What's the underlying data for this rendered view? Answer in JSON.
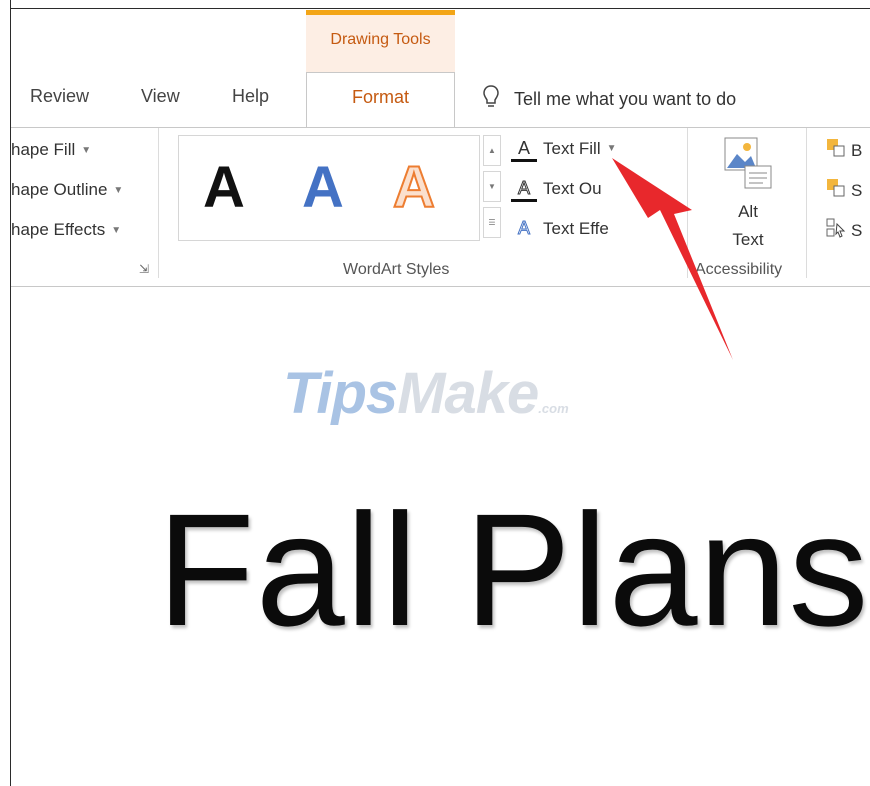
{
  "ribbon": {
    "context_tab_group": "Drawing Tools",
    "tabs": [
      "Review",
      "View",
      "Help",
      "Format"
    ],
    "active_tab": "Format",
    "tell_me": "Tell me what you want to do",
    "shape_styles": {
      "shape_fill": "hape Fill",
      "shape_outline": "hape Outline",
      "shape_effects": "hape Effects"
    },
    "wordart_styles": {
      "label": "WordArt Styles",
      "samples": [
        "A",
        "A",
        "A"
      ],
      "text_fill": "Text Fill",
      "text_outline": "Text Ou",
      "text_effects": "Text Effe"
    },
    "accessibility": {
      "alt_text_line1": "Alt",
      "alt_text_line2": "Text",
      "label": "Accessibility"
    },
    "arrange_partial": [
      "B",
      "S",
      "S"
    ]
  },
  "document": {
    "watermark": {
      "part1": "T",
      "part2": "ips",
      "part3": "Make",
      "part4": ".com"
    },
    "title": "Fall Plans"
  },
  "colors": {
    "accent_orange": "#c55a11",
    "context_bar": "#f3a516",
    "wordart_blue": "#4472c4",
    "arrow_red": "#e8282c"
  }
}
